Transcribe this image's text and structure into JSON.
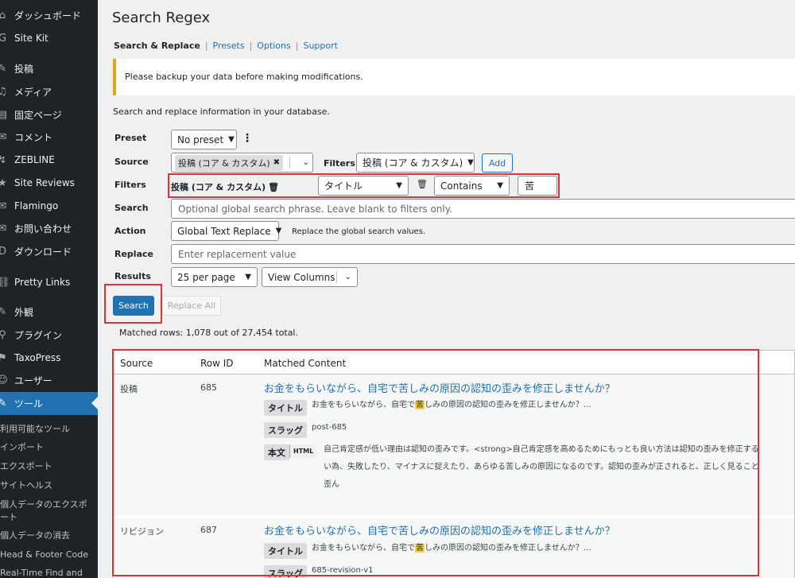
{
  "sidebar": {
    "menu": [
      {
        "icon": "dashboard-icon",
        "glyph": "⌂",
        "label": "ダッシュボード"
      },
      {
        "icon": "sitekit-icon",
        "glyph": "G",
        "label": "Site Kit"
      },
      {
        "icon": "pin-icon",
        "glyph": "✎",
        "label": "投稿"
      },
      {
        "icon": "media-icon",
        "glyph": "♫",
        "label": "メディア"
      },
      {
        "icon": "page-icon",
        "glyph": "▤",
        "label": "固定ページ"
      },
      {
        "icon": "comment-icon",
        "glyph": "✉",
        "label": "コメント"
      },
      {
        "icon": "zebline-icon",
        "glyph": "↯",
        "label": "ZEBLINE"
      },
      {
        "icon": "star-icon",
        "glyph": "★",
        "label": "Site Reviews"
      },
      {
        "icon": "flamingo-icon",
        "glyph": "✉",
        "label": "Flamingo"
      },
      {
        "icon": "mail-icon",
        "glyph": "✉",
        "label": "お問い合わせ"
      },
      {
        "icon": "download-icon",
        "glyph": "D",
        "label": "ダウンロード"
      },
      {
        "icon": "link-icon",
        "glyph": "⛓",
        "label": "Pretty Links"
      },
      {
        "icon": "appearance-icon",
        "glyph": "✎",
        "label": "外観"
      },
      {
        "icon": "plugin-icon",
        "glyph": "⚲",
        "label": "プラグイン"
      },
      {
        "icon": "taxopress-icon",
        "glyph": "⚑",
        "label": "TaxoPress"
      },
      {
        "icon": "user-icon",
        "glyph": "☺",
        "label": "ユーザー"
      },
      {
        "icon": "wrench-icon",
        "glyph": "✎",
        "label": "ツール"
      }
    ],
    "submenu": [
      "利用可能なツール",
      "インポート",
      "エクスポート",
      "サイトヘルス",
      "個人データのエクスポート",
      "個人データの消去",
      "Head & Footer Code",
      "Real-Time Find and"
    ]
  },
  "page": {
    "title": "Search Regex",
    "subnav": {
      "current": "Search & Replace",
      "links": [
        "Presets",
        "Options",
        "Support"
      ],
      "sep": "|"
    },
    "notice": "Please backup your data before making modifications.",
    "intro": "Search and replace information in your database."
  },
  "form": {
    "preset": {
      "label": "Preset",
      "value": "No preset",
      "more": "⋮"
    },
    "source": {
      "label": "Source",
      "tag": "投稿 (コア & カスタム)",
      "remove": "✖",
      "filters_label": "Filters",
      "filters_value": "投稿 (コア & カスタム)",
      "add_label": "Add"
    },
    "filters": {
      "label": "Filters",
      "group": "投稿 (コア & カスタム)",
      "column": "タイトル",
      "operator": "Contains",
      "value": "苦"
    },
    "search": {
      "label": "Search",
      "placeholder": "Optional global search phrase. Leave blank to filters only."
    },
    "action": {
      "label": "Action",
      "value": "Global Text Replace",
      "help": "Replace the global search values."
    },
    "replace": {
      "label": "Replace",
      "placeholder": "Enter replacement value"
    },
    "results": {
      "label": "Results",
      "per_page": "25 per page",
      "columns": "View Columns"
    },
    "search_button": "Search",
    "replace_all_button": "Replace All",
    "matched": "Matched rows: 1,078 out of 27,454 total."
  },
  "table": {
    "headers": [
      "Source",
      "Row ID",
      "Matched Content"
    ],
    "rows": [
      {
        "source": "投稿",
        "row_id": "685",
        "title": "お金をもらいながら、自宅で苦しみの原因の認知の歪みを修正しませんか？",
        "fields": [
          {
            "label": "タイトル",
            "before": "お金をもらいながら、自宅で",
            "match": "苦",
            "after": "しみの原因の認知の歪みを修正しませんか？…"
          },
          {
            "label": "スラッグ",
            "text": "post-685"
          },
          {
            "label": "本文",
            "badge": "HTML",
            "lines": [
              "自己肯定感が低い理由は認知の歪みです。<strong>自己肯定感を高めるためにもっとも良い方法は認知の歪みを修正する",
              "い為、失敗したり、マイナスに捉えたり、あらゆる苦しみの原因になるのです。認知の歪みが正されると、正しく見ること",
              "歪ん"
            ]
          }
        ]
      },
      {
        "source": "リビジョン",
        "row_id": "687",
        "title": "お金をもらいながら、自宅で苦しみの原因の認知の歪みを修正しませんか？",
        "fields": [
          {
            "label": "タイトル",
            "before": "お金をもらいながら、自宅で",
            "match": "苦",
            "after": "しみの原因の認知の歪みを修正しませんか？…"
          },
          {
            "label": "スラッグ",
            "text": "685-revision-v1"
          }
        ]
      }
    ]
  }
}
